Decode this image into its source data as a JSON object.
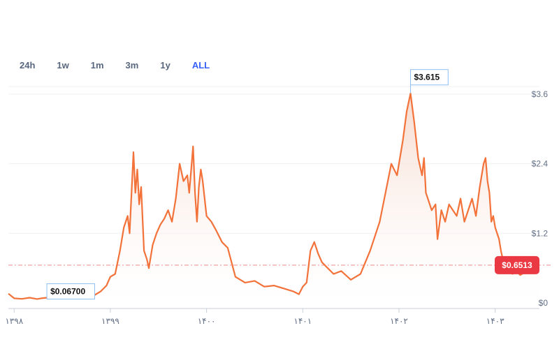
{
  "range_tabs": [
    {
      "label": "24h",
      "active": false
    },
    {
      "label": "1w",
      "active": false
    },
    {
      "label": "1m",
      "active": false
    },
    {
      "label": "3m",
      "active": false
    },
    {
      "label": "1y",
      "active": false
    },
    {
      "label": "ALL",
      "active": true
    }
  ],
  "colors": {
    "line": "#f2723a",
    "area_top": "#f5d6c8",
    "grid": "#eef0f3",
    "axis": "#c9ced8",
    "current_badge": "#ea3943",
    "current_line": "#f08a8a",
    "annotation_border": "#8fbff0",
    "active_tab": "#3861fb"
  },
  "chart_data": {
    "type": "line",
    "title": "",
    "xlabel": "",
    "ylabel": "",
    "y_tick_labels": [
      "$0",
      "$1.2",
      "$2.4",
      "$3.6"
    ],
    "y_ticks": [
      0,
      1.2,
      2.4,
      3.6
    ],
    "ylim": [
      0,
      3.9
    ],
    "x_tick_labels": [
      "۱۳۹۸",
      "۱۳۹۹",
      "۱۴۰۰",
      "۱۴۰۱",
      "۱۴۰۲",
      "۱۴۰۳"
    ],
    "x_ticks": [
      0,
      1,
      2,
      3,
      4,
      5
    ],
    "xlim": [
      -0.06,
      5.46
    ],
    "grid": true,
    "series": [
      {
        "x": [
          -0.06,
          0.0,
          0.08,
          0.16,
          0.24,
          0.28,
          0.34,
          0.42,
          0.5,
          0.58,
          0.66,
          0.74,
          0.82,
          0.9,
          0.96,
          1.0,
          1.05,
          1.1,
          1.14,
          1.18,
          1.2,
          1.24,
          1.26,
          1.28,
          1.3,
          1.32,
          1.35,
          1.38,
          1.4,
          1.44,
          1.48,
          1.52,
          1.56,
          1.6,
          1.64,
          1.68,
          1.72,
          1.76,
          1.8,
          1.82,
          1.84,
          1.86,
          1.88,
          1.9,
          1.92,
          1.94,
          1.96,
          2.0,
          2.05,
          2.1,
          2.16,
          2.22,
          2.3,
          2.4,
          2.5,
          2.6,
          2.7,
          2.8,
          2.9,
          2.96,
          3.0,
          3.04,
          3.08,
          3.12,
          3.16,
          3.2,
          3.26,
          3.32,
          3.4,
          3.5,
          3.6,
          3.7,
          3.8,
          3.86,
          3.92,
          3.98,
          4.04,
          4.08,
          4.12,
          4.16,
          4.2,
          4.24,
          4.26,
          4.28,
          4.3,
          4.34,
          4.38,
          4.4,
          4.44,
          4.48,
          4.52,
          4.56,
          4.6,
          4.64,
          4.68,
          4.72,
          4.76,
          4.8,
          4.84,
          4.88,
          4.9,
          4.92,
          4.94,
          4.96,
          4.98,
          5.0,
          5.04,
          5.06,
          5.1,
          5.14,
          5.18,
          5.22,
          5.26,
          5.3,
          5.34,
          5.38,
          5.42,
          5.46
        ],
        "y": [
          0.16,
          0.08,
          0.07,
          0.09,
          0.067,
          0.08,
          0.09,
          0.12,
          0.15,
          0.22,
          0.3,
          0.16,
          0.12,
          0.2,
          0.3,
          0.45,
          0.5,
          0.9,
          1.3,
          1.5,
          1.2,
          2.6,
          1.9,
          2.3,
          1.7,
          2.0,
          0.9,
          0.75,
          0.6,
          1.0,
          1.2,
          1.35,
          1.45,
          1.6,
          1.4,
          1.8,
          2.4,
          2.1,
          2.2,
          1.9,
          2.3,
          2.7,
          1.9,
          1.4,
          2.0,
          2.3,
          2.1,
          1.5,
          1.4,
          1.25,
          1.05,
          0.95,
          0.45,
          0.35,
          0.38,
          0.28,
          0.3,
          0.25,
          0.2,
          0.15,
          0.28,
          0.35,
          0.9,
          1.05,
          0.85,
          0.7,
          0.6,
          0.5,
          0.55,
          0.4,
          0.5,
          0.9,
          1.4,
          1.9,
          2.4,
          2.2,
          2.8,
          3.3,
          3.615,
          3.1,
          2.5,
          2.2,
          2.5,
          1.9,
          1.8,
          1.6,
          1.7,
          1.1,
          1.6,
          1.4,
          1.7,
          1.6,
          1.5,
          1.8,
          1.4,
          1.6,
          1.8,
          1.5,
          2.0,
          2.4,
          2.5,
          2.1,
          1.9,
          1.4,
          1.5,
          1.3,
          1.1,
          0.9,
          0.6,
          0.55,
          0.5,
          0.55,
          0.48,
          0.52,
          0.6,
          0.65,
          0.6,
          0.6
        ]
      }
    ],
    "annotations": [
      {
        "label": "$0.06700",
        "x": 0.34,
        "y": 0.067,
        "kind": "low"
      },
      {
        "label": "$3.615",
        "x": 4.12,
        "y": 3.615,
        "kind": "high"
      }
    ],
    "current": {
      "label": "$0.6513",
      "value": 0.6513
    }
  }
}
